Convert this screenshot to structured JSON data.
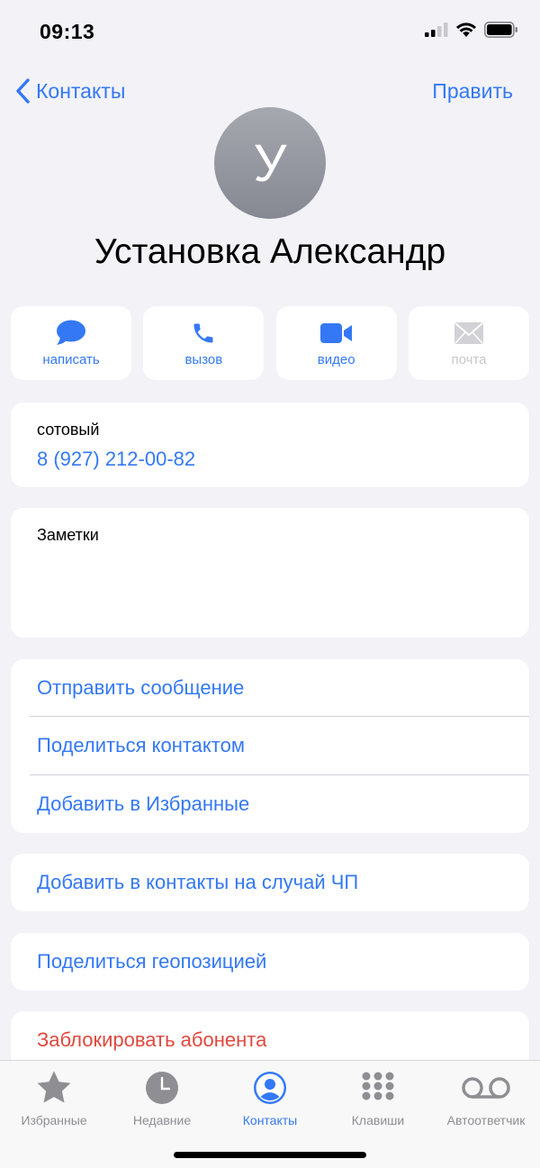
{
  "status": {
    "time": "09:13"
  },
  "nav": {
    "back_label": "Контакты",
    "edit_label": "Править"
  },
  "contact": {
    "initial": "У",
    "name": "Установка Александр"
  },
  "actions": [
    {
      "label": "написать",
      "icon": "message-bubble-icon",
      "enabled": true
    },
    {
      "label": "вызов",
      "icon": "phone-icon",
      "enabled": true
    },
    {
      "label": "видео",
      "icon": "video-camera-icon",
      "enabled": true
    },
    {
      "label": "почта",
      "icon": "mail-envelope-icon",
      "enabled": false
    }
  ],
  "phone": {
    "label": "сотовый",
    "value": "8 (927) 212-00-82"
  },
  "notes": {
    "label": "Заметки"
  },
  "options": {
    "send_message": "Отправить сообщение",
    "share_contact": "Поделиться контактом",
    "add_favorites": "Добавить в Избранные"
  },
  "emergency": {
    "label": "Добавить в контакты на случай ЧП"
  },
  "location": {
    "label": "Поделиться геопозицией"
  },
  "block": {
    "label": "Заблокировать абонента"
  },
  "tabs": [
    {
      "label": "Избранные",
      "icon": "star-icon",
      "active": false
    },
    {
      "label": "Недавние",
      "icon": "clock-icon",
      "active": false
    },
    {
      "label": "Контакты",
      "icon": "person-circle-icon",
      "active": true
    },
    {
      "label": "Клавиши",
      "icon": "keypad-icon",
      "active": false
    },
    {
      "label": "Автоответчик",
      "icon": "voicemail-icon",
      "active": false
    }
  ],
  "colors": {
    "accent": "#3478f6",
    "destructive": "#e0483d",
    "inactive": "#8e8e93",
    "background": "#f2f2f7"
  }
}
